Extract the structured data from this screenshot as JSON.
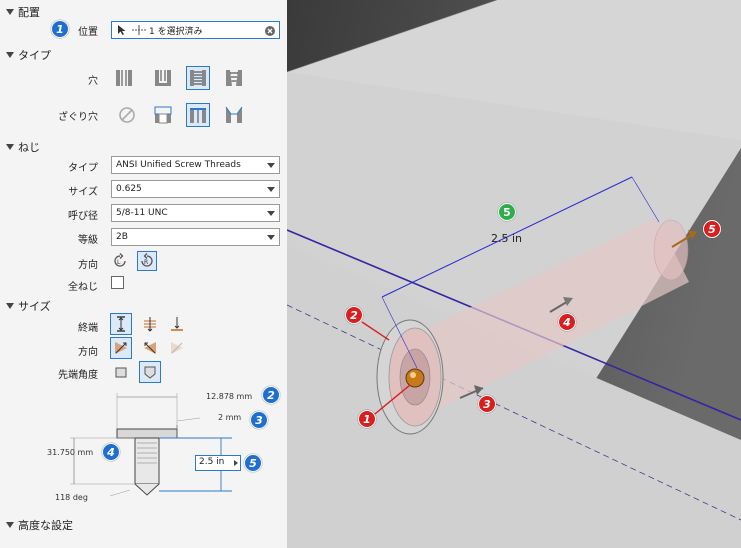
{
  "placement": {
    "section": "配置",
    "position_label": "位置",
    "position_value": "1 を選択済み",
    "badge": "1"
  },
  "type": {
    "section": "タイプ",
    "hole_label": "穴",
    "counterbore_label": "ざぐり穴"
  },
  "thread": {
    "section": "ねじ",
    "type_label": "タイプ",
    "type_value": "ANSI Unified Screw Threads",
    "size_label": "サイズ",
    "size_value": "0.625",
    "designation_label": "呼び径",
    "designation_value": "5/8-11 UNC",
    "class_label": "等級",
    "class_value": "2B",
    "direction_label": "方向",
    "full_thread_label": "全ねじ"
  },
  "size": {
    "section": "サイズ",
    "termination_label": "終端",
    "direction_label": "方向",
    "drill_point_label": "先端角度"
  },
  "diagram": {
    "dim_diameter": "12.878 mm",
    "dim_depth": "2 mm",
    "dim_length": "31.750 mm",
    "dim_angle": "118 deg",
    "dim_value": "2.5 in",
    "badge2": "2",
    "badge3": "3",
    "badge4": "4",
    "badge5": "5"
  },
  "advanced": {
    "section": "高度な設定"
  },
  "viewport": {
    "dimension": "2.5 in",
    "badge_green": "5",
    "badge1": "1",
    "badge2": "2",
    "badge3": "3",
    "badge4": "4",
    "badge5": "5"
  }
}
